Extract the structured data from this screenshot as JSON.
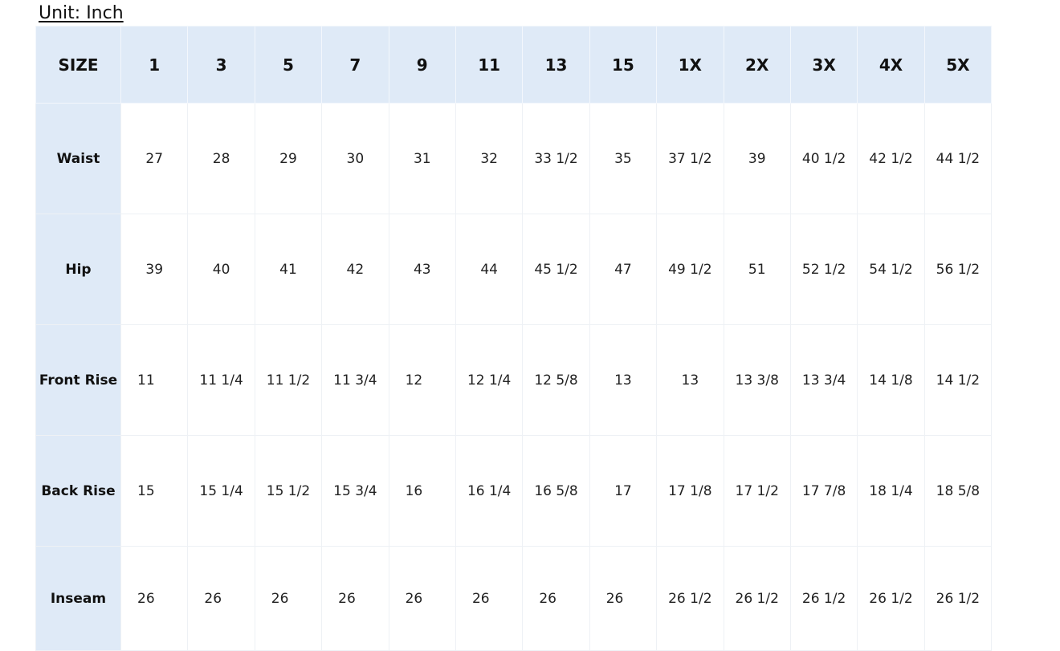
{
  "unit_label": "Unit: Inch",
  "table": {
    "header_label": "SIZE",
    "sizes": [
      "1",
      "3",
      "5",
      "7",
      "9",
      "11",
      "13",
      "15",
      "1X",
      "2X",
      "3X",
      "4X",
      "5X"
    ],
    "rows": [
      {
        "label": "Waist",
        "values": [
          "27",
          "28",
          "29",
          "30",
          "31",
          "32",
          "33 1/2",
          "35",
          "37 1/2",
          "39",
          "40 1/2",
          "42 1/2",
          "44 1/2"
        ]
      },
      {
        "label": "Hip",
        "values": [
          "39",
          "40",
          "41",
          "42",
          "43",
          "44",
          "45 1/2",
          "47",
          "49 1/2",
          "51",
          "52 1/2",
          "54 1/2",
          "56 1/2"
        ]
      },
      {
        "label": "Front Rise",
        "values": [
          "11",
          "11 1/4",
          "11 1/2",
          "11 3/4",
          "12",
          "12 1/4",
          "12 5/8",
          "13",
          "13",
          "13 3/8",
          "13 3/4",
          "14 1/8",
          "14 1/2"
        ]
      },
      {
        "label": "Back Rise",
        "values": [
          "15",
          "15 1/4",
          "15 1/2",
          "15 3/4",
          "16",
          "16 1/4",
          "16 5/8",
          "17",
          "17 1/8",
          "17 1/2",
          "17 7/8",
          "18 1/4",
          "18 5/8"
        ]
      },
      {
        "label": "Inseam",
        "values": [
          "26",
          "26",
          "26",
          "26",
          "26",
          "26",
          "26",
          "26",
          "26 1/2",
          "26 1/2",
          "26 1/2",
          "26 1/2",
          "26 1/2"
        ]
      }
    ]
  },
  "colors": {
    "header_background": "#dfeaf7",
    "grid_line": "#eef1f5",
    "text": "#111111"
  }
}
